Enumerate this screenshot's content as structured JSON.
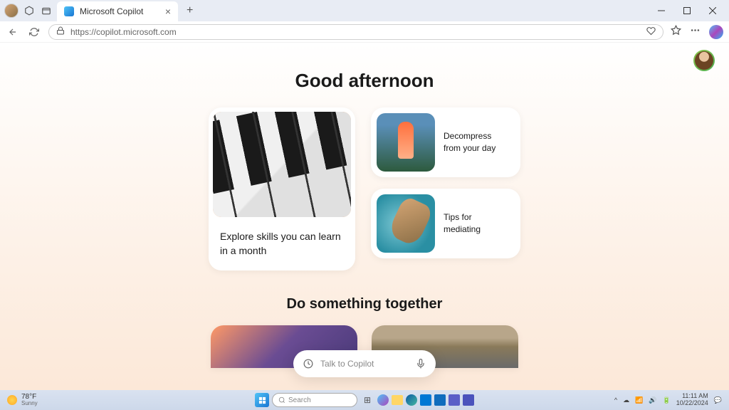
{
  "browser": {
    "tab_title": "Microsoft Copilot",
    "url": "https://copilot.microsoft.com"
  },
  "page": {
    "greeting": "Good afternoon",
    "cards": {
      "large": "Explore skills you can learn in a month",
      "small1": "Decompress from your day",
      "small2": "Tips for mediating"
    },
    "section2": "Do something together",
    "input_placeholder": "Talk to Copilot"
  },
  "taskbar": {
    "temp": "78°F",
    "condition": "Sunny",
    "search_placeholder": "Search",
    "time": "11:11 AM",
    "date": "10/22/2024"
  }
}
